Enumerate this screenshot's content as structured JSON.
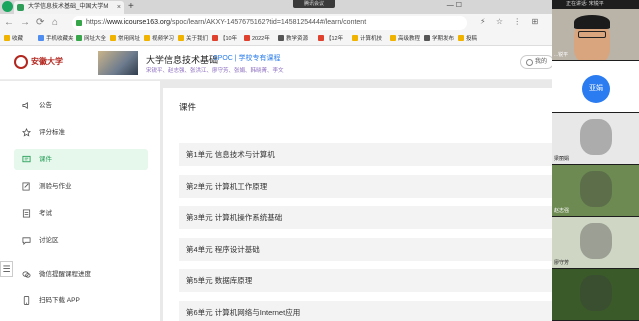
{
  "browser": {
    "tab_title": "大学信息技术基础_中国大学M",
    "tab_close": "×",
    "new_tab": "+",
    "meeting_bar": "腾讯会议",
    "window_buttons": "—  ☐",
    "nav": {
      "back": "←",
      "forward": "→",
      "reload": "⟳",
      "home": "⌂"
    },
    "url_prefix": "https://",
    "url_host": "www.icourse163.org",
    "url_path": "/spoc/learn/AKXY-1457675162?tid=1458125444#/learn/content",
    "nav_icons": "⚡ ☆ ⋮ ⊞"
  },
  "bookmarks": [
    {
      "label": "收藏",
      "color": "#f0b400"
    },
    {
      "label": "手机收藏夹",
      "color": "#4f8ef0"
    },
    {
      "label": "网址大全",
      "color": "#37a64a"
    },
    {
      "label": "常用网址",
      "color": "#f0b400"
    },
    {
      "label": "视频学习",
      "color": "#f0b400"
    },
    {
      "label": "关于我们",
      "color": "#f0b400"
    },
    {
      "label": "【10年",
      "color": "#e0412e"
    },
    {
      "label": "2022年",
      "color": "#e0412e"
    },
    {
      "label": "教学资源",
      "color": "#555555"
    },
    {
      "label": "【12年",
      "color": "#e0412e"
    },
    {
      "label": "计算机技",
      "color": "#f0b400"
    },
    {
      "label": "高级教程",
      "color": "#f0b400"
    },
    {
      "label": "学期发布",
      "color": "#555555"
    },
    {
      "label": "投稿",
      "color": "#f0b400"
    }
  ],
  "header": {
    "logo_text": "安徽大学",
    "course_title": "大学信息技术基础",
    "spoc_label": "SPOC | 学校专有课程",
    "teachers": "宋锐平、赵志强、张洪江、廖守芳、张娟、韩晓菁、李文",
    "action_label": "我的"
  },
  "sidebar": {
    "items": [
      {
        "label": "公告",
        "icon": "speaker-icon"
      },
      {
        "label": "评分标准",
        "icon": "star-icon"
      },
      {
        "label": "课件",
        "icon": "courseware-icon"
      },
      {
        "label": "测验与作业",
        "icon": "edit-icon"
      },
      {
        "label": "考试",
        "icon": "exam-icon"
      },
      {
        "label": "讨论区",
        "icon": "chat-icon"
      },
      {
        "label": "微信提醒课程进度",
        "icon": "wechat-icon"
      },
      {
        "label": "扫码下载 APP",
        "icon": "phone-icon"
      }
    ],
    "active_index": 2,
    "handle_glyph": "☰"
  },
  "content": {
    "title": "课件",
    "units": [
      "第1单元 信息技术与计算机",
      "第2单元 计算机工作原理",
      "第3单元 计算机操作系统基础",
      "第4单元 程序设计基础",
      "第5单元 数据库原理",
      "第6单元 计算机网络与Internet应用"
    ]
  },
  "video_panel": {
    "top_label": "正在讲话: 宋锐平",
    "tiles": [
      {
        "name": "...锐平",
        "type": "camera"
      },
      {
        "name": "亚娟",
        "type": "avatar"
      },
      {
        "name": "梁丽娟",
        "type": "screen"
      },
      {
        "name": "赵志强",
        "type": "camera"
      },
      {
        "name": "廖守芳",
        "type": "camera"
      },
      {
        "name": "",
        "type": "camera"
      }
    ],
    "avatar_color": "#2b7cf0"
  }
}
